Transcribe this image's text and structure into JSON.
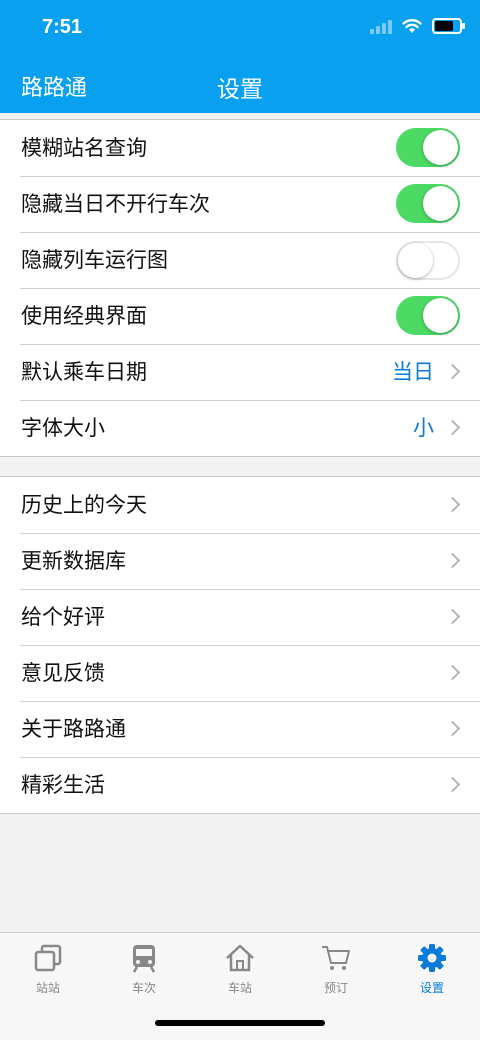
{
  "status": {
    "time": "7:51"
  },
  "header": {
    "back_label": "路路通",
    "title": "设置"
  },
  "settings": {
    "toggles": [
      {
        "label": "模糊站名查询",
        "on": true
      },
      {
        "label": "隐藏当日不开行车次",
        "on": true
      },
      {
        "label": "隐藏列车运行图",
        "on": false
      },
      {
        "label": "使用经典界面",
        "on": true
      }
    ],
    "value_rows": [
      {
        "label": "默认乘车日期",
        "value": "当日"
      },
      {
        "label": "字体大小",
        "value": "小"
      }
    ]
  },
  "links": [
    {
      "label": "历史上的今天"
    },
    {
      "label": "更新数据库"
    },
    {
      "label": "给个好评"
    },
    {
      "label": "意见反馈"
    },
    {
      "label": "关于路路通"
    },
    {
      "label": "精彩生活"
    }
  ],
  "tabs": [
    {
      "label": "站站",
      "icon": "station-to-station-icon"
    },
    {
      "label": "车次",
      "icon": "train-icon"
    },
    {
      "label": "车站",
      "icon": "home-icon"
    },
    {
      "label": "预订",
      "icon": "cart-icon"
    },
    {
      "label": "设置",
      "icon": "gear-icon"
    }
  ],
  "colors": {
    "header": "#0aa0f0",
    "accent": "#0a7bd8",
    "toggle_on": "#4cd964"
  }
}
